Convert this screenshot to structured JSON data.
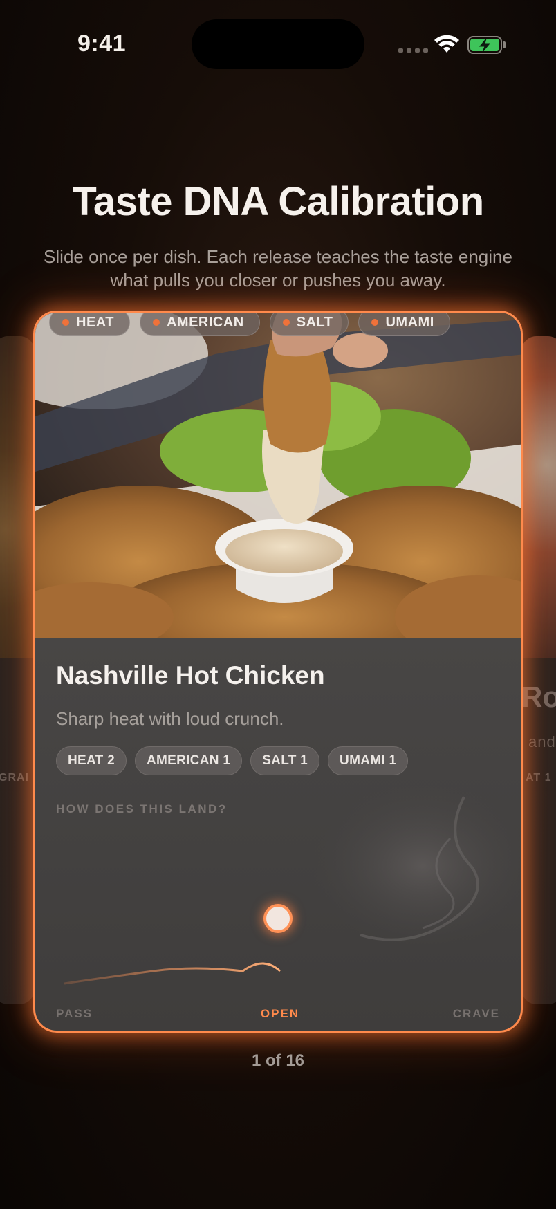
{
  "status_bar": {
    "time": "9:41",
    "icons": [
      "signal-dots",
      "wifi-icon",
      "battery-charging-icon"
    ]
  },
  "header": {
    "title": "Taste DNA Calibration",
    "subtitle": "Slide once per dish. Each release teaches the taste engine what pulls you closer or pushes you away."
  },
  "card": {
    "top_tags": [
      "HEAT",
      "AMERICAN",
      "SALT",
      "UMAMI"
    ],
    "dish_name": "Nashville Hot Chicken",
    "description": "Sharp heat with loud crunch.",
    "flavor_chips": [
      "HEAT 2",
      "AMERICAN 1",
      "SALT 1",
      "UMAMI 1"
    ],
    "question": "HOW DOES THIS LAND?",
    "slider": {
      "labels": [
        "PASS",
        "OPEN",
        "CRAVE"
      ],
      "selected": "OPEN",
      "value_fraction": 0.5
    }
  },
  "side_cards": {
    "left_tag_fragment": "GRAI",
    "right_title_fragment": "Ro",
    "right_desc_fragment": "and",
    "right_tag_fragment": "AT 1"
  },
  "pager": {
    "text": "1 of 16"
  },
  "colors": {
    "accent": "#ff8a4c",
    "tag_dot": "#f0723a",
    "background": "#160d08"
  }
}
